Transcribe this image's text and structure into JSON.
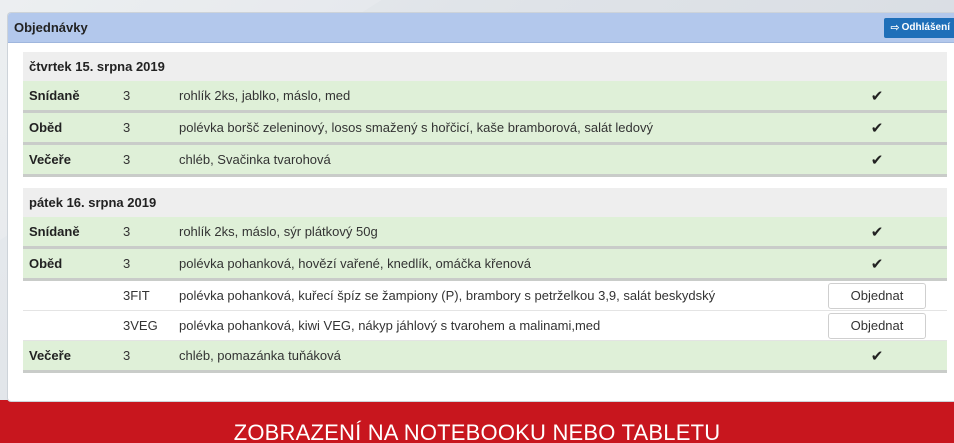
{
  "panel": {
    "title": "Objednávky",
    "logout_label": "Odhlášení",
    "logout_icon": "sign-out-icon"
  },
  "days": [
    {
      "label": "čtvrtek 15. srpna 2019",
      "rows": [
        {
          "meal": "Snídaně",
          "code": "3",
          "desc": "rohlík 2ks, jablko, máslo, med",
          "status": "✔"
        },
        {
          "meal": "Oběd",
          "code": "3",
          "desc": "polévka boršč zeleninový, losos smažený s hořčicí, kaše bramborová, salát ledový",
          "status": "✔"
        },
        {
          "meal": "Večeře",
          "code": "3",
          "desc": "chléb, Svačinka tvarohová",
          "status": "✔"
        }
      ]
    },
    {
      "label": "pátek 16. srpna 2019",
      "rows": [
        {
          "meal": "Snídaně",
          "code": "3",
          "desc": "rohlík 2ks, máslo, sýr plátkový 50g",
          "status": "✔"
        },
        {
          "meal": "Oběd",
          "code": "3",
          "desc": "polévka pohanková, hovězí vařené, knedlík, omáčka křenová",
          "status": "✔"
        },
        {
          "meal": "",
          "code": "3FIT",
          "desc": "polévka pohanková, kuřecí špíz se žampiony (P), brambory s petrželkou 3,9, salát beskydský",
          "button": "Objednat"
        },
        {
          "meal": "",
          "code": "3VEG",
          "desc": "polévka pohanková, kiwi VEG, nákyp jáhlový s tvarohem a malinami,med",
          "button": "Objednat"
        },
        {
          "meal": "Večeře",
          "code": "3",
          "desc": "chléb, pomazánka tuňáková",
          "status": "✔"
        }
      ]
    }
  ],
  "banner": "ZOBRAZENÍ NA NOTEBOOKU NEBO TABLETU",
  "colors": {
    "header": "#b3c8ec",
    "ordered_row": "#dff0d8",
    "logout": "#1e6fb9",
    "banner_bg": "#c8161e"
  }
}
